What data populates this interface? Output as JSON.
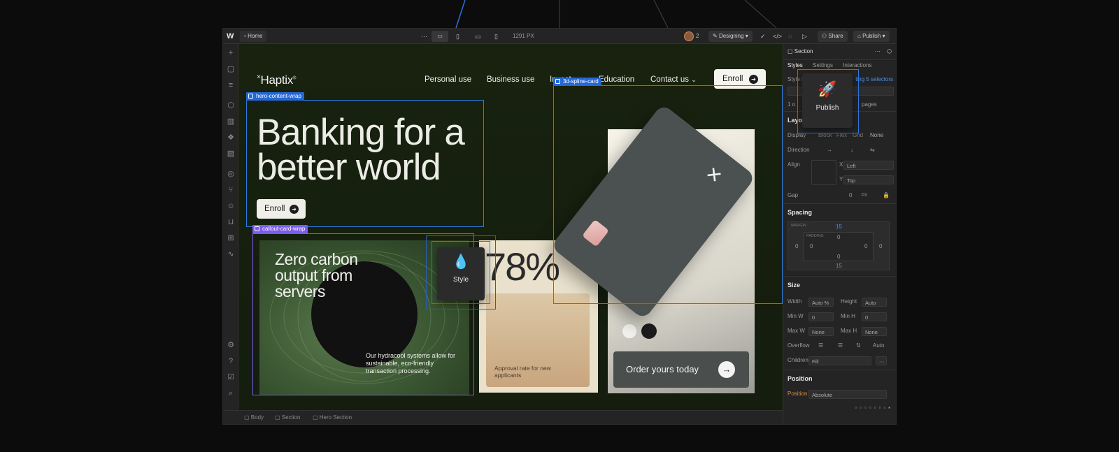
{
  "topbar": {
    "home_label": "Home",
    "more_label": "···",
    "width_readout": "1291 PX",
    "collaborators_count": "2",
    "mode_label": "Designing",
    "share_label": "Share",
    "publish_label": "Publish"
  },
  "site": {
    "logo": "Haptix",
    "nav": [
      "Personal use",
      "Business use",
      "Invest",
      "Education",
      "Contact us"
    ],
    "nav_enroll": "Enroll",
    "hero_title": "Banking for a better world",
    "hero_enroll": "Enroll",
    "callout_title": "Zero carbon output from servers",
    "callout_body": "Our hydracool systems allow for sustainable, eco-friendly transaction processing.",
    "stat_number": "78%",
    "stat_caption": "Approval rate for new applicants",
    "order_button": "Order yours today",
    "card_colors": [
      "#f2f1ec",
      "#1c1c1c"
    ]
  },
  "selections": {
    "hero_tag": "hero-content-wrap",
    "callout_tag": "callout-card-wrap",
    "spline_tag": "3d-spline-card"
  },
  "tooltips": {
    "style": "Style",
    "publish": "Publish"
  },
  "right_panel": {
    "element": "Section",
    "tabs": [
      "Styles",
      "Settings",
      "Interactions"
    ],
    "selector_note": "ting 5 selectors",
    "pages_note": "pages",
    "layout_title": "Layout",
    "display_label": "Display",
    "display_options": [
      "Block",
      "Flex",
      "Grid",
      "None"
    ],
    "direction_label": "Direction",
    "align_label": "Align",
    "align_x": "Left",
    "align_y": "Top",
    "gap_label": "Gap",
    "gap_value": "0",
    "gap_unit": "PX",
    "spacing_title": "Spacing",
    "margin_label": "MARGIN",
    "padding_label": "PADDING",
    "margin_top": "15",
    "margin_bottom": "15",
    "margin_left": "0",
    "margin_right": "0",
    "padding_top": "0",
    "padding_bottom": "0",
    "padding_left": "0",
    "padding_right": "0",
    "size_title": "Size",
    "width_label": "Width",
    "width_value": "Auto",
    "width_unit": "%",
    "height_label": "Height",
    "height_value": "Auto",
    "minw_label": "Min W",
    "minw_value": "0",
    "minh_label": "Min H",
    "minh_value": "0",
    "maxw_label": "Max W",
    "maxw_value": "None",
    "maxh_label": "Max H",
    "maxh_value": "None",
    "overflow_label": "Overflow",
    "overflow_auto": "Auto",
    "children_label": "Children",
    "children_value": "Fill",
    "position_title": "Position",
    "position_label": "Position",
    "position_value": "Absolute"
  },
  "breadcrumb": [
    "Body",
    "Section",
    "Hero Section"
  ],
  "colors": {
    "selection_blue": "#2e7ae6",
    "selection_purple": "#7b5cf0",
    "canvas_bg": "#18220f"
  }
}
